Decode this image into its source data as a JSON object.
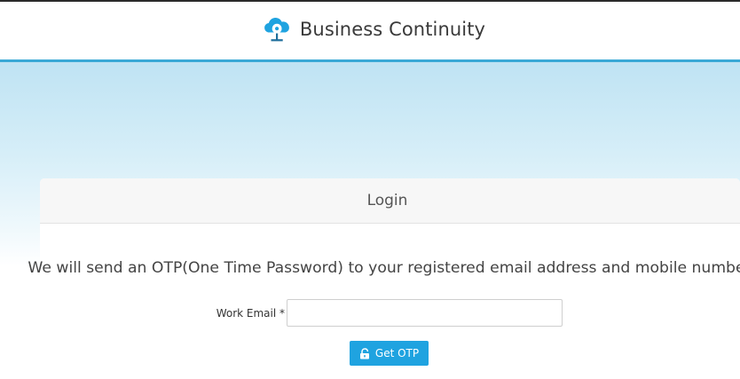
{
  "header": {
    "app_title": "Business Continuity",
    "logo_icon": "cloud-network-icon",
    "accent_color": "#3aa9d6"
  },
  "login": {
    "title": "Login",
    "otp_message": "We will send an OTP(One Time Password) to your registered email address and mobile number",
    "email_label": "Work Email *",
    "email_value": "",
    "email_placeholder": "",
    "get_otp_label": "Get OTP",
    "get_otp_icon": "unlock-icon",
    "button_color": "#1fa3e0"
  }
}
